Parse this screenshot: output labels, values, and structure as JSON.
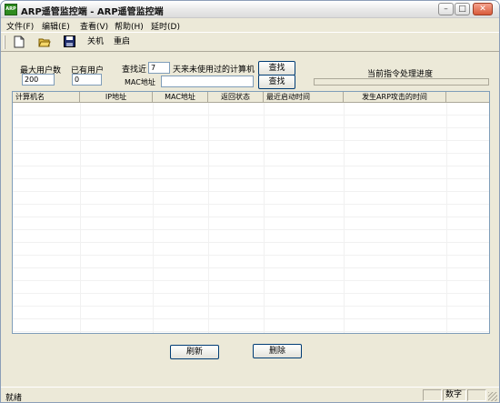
{
  "window": {
    "title": "ARP遥管监控端 - ARP遥管监控端",
    "icon_text": "ARP"
  },
  "menu": [
    {
      "label": "文件(F)"
    },
    {
      "label": "编辑(E)"
    },
    {
      "label": "查看(V)"
    },
    {
      "label": "帮助(H)"
    },
    {
      "label": "延时(D)"
    }
  ],
  "toolbar": {
    "shutdown": "关机",
    "restart": "重启"
  },
  "form": {
    "max_users_label": "最大用户数",
    "max_users_value": "200",
    "existing_users_label": "已有用户",
    "existing_users_value": "0",
    "find_recent_label": "查找近",
    "days_value": "7",
    "days_suffix": "天来未使用过的计算机",
    "mac_label": "MAC地址",
    "mac_value": "",
    "search_button_1": "查找",
    "search_button_2": "查找",
    "progress_label": "当前指令处理进度",
    "progress": 0
  },
  "table": {
    "columns": [
      "计算机名",
      "IP地址",
      "MAC地址",
      "返回状态",
      "最近启动时间",
      "发生ARP攻击的时间"
    ],
    "rows": []
  },
  "actions": {
    "refresh": "刷新",
    "delete": "删除"
  },
  "status": {
    "text": "就绪",
    "num": "数字"
  },
  "colors": {
    "accent": "#003c74",
    "progress": "#3a9c2a",
    "face": "#ece9d8"
  }
}
